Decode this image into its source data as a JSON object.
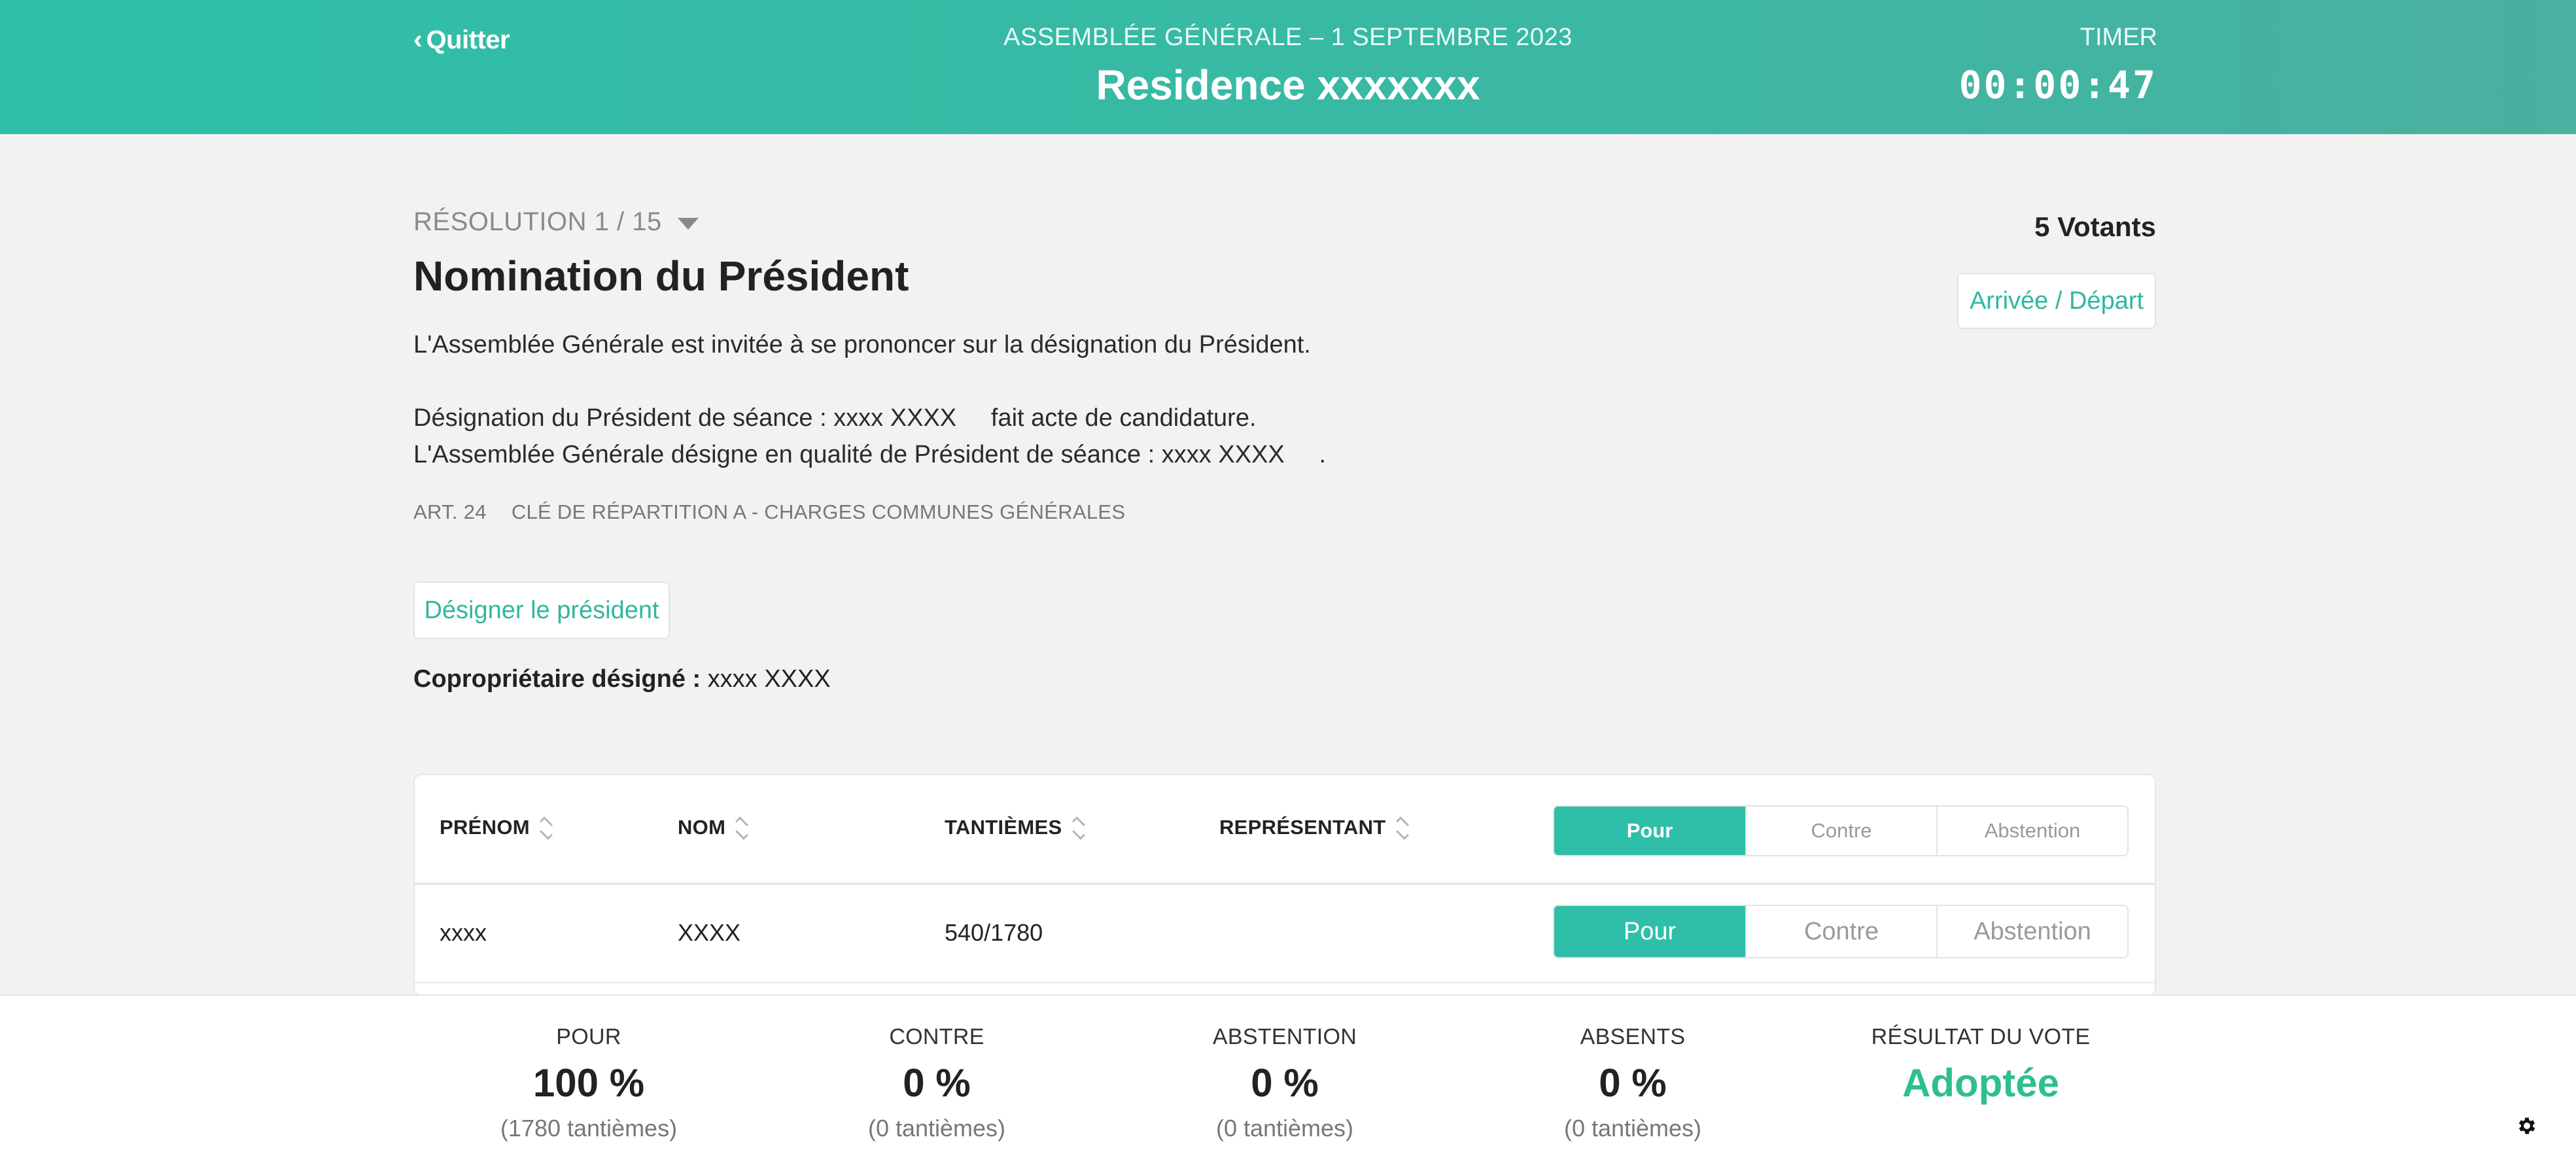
{
  "header": {
    "back_label": "Quitter",
    "subtitle": "ASSEMBLÉE GÉNÉRALE – 1 SEPTEMBRE 2023",
    "title": "Residence xxxxxxx",
    "timer_label": "TIMER",
    "timer_value": "00:00:47"
  },
  "resolution": {
    "counter": "RÉSOLUTION 1 / 15",
    "title": "Nomination du Président",
    "votants": "5 Votants",
    "arrival_button": "Arrivée / Départ",
    "description_lines": [
      "L'Assemblée Générale est invitée à se prononcer sur la désignation du Président.",
      "Désignation du Président de séance : xxxx XXXX     fait acte de candidature.",
      "L'Assemblée Générale désigne en qualité de Président de séance : xxxx XXXX     ."
    ],
    "article": "ART. 24",
    "cle": "CLÉ DE RÉPARTITION A - CHARGES COMMUNES GÉNÉRALES",
    "designate_button": "Désigner le président",
    "designated_label": "Copropriétaire désigné :",
    "designated_value": "xxxx XXXX"
  },
  "table": {
    "headers": {
      "prenom": "PRÉNOM",
      "nom": "NOM",
      "tantiemes": "TANTIÈMES",
      "representant": "REPRÉSENTANT"
    },
    "bulk_vote": {
      "pour": "Pour",
      "contre": "Contre",
      "abstention": "Abstention",
      "selected": "pour"
    },
    "rows": [
      {
        "prenom": "xxxx",
        "nom": "XXXX",
        "tantiemes": "540/1780",
        "representant": "",
        "vote": {
          "pour": "Pour",
          "contre": "Contre",
          "abstention": "Abstention",
          "selected": "pour"
        }
      }
    ]
  },
  "footer": {
    "pour": {
      "label": "POUR",
      "value": "100 %",
      "sub": "(1780 tantièmes)"
    },
    "contre": {
      "label": "CONTRE",
      "value": "0 %",
      "sub": "(0 tantièmes)"
    },
    "abstention": {
      "label": "ABSTENTION",
      "value": "0 %",
      "sub": "(0 tantièmes)"
    },
    "absents": {
      "label": "ABSENTS",
      "value": "0 %",
      "sub": "(0 tantièmes)"
    },
    "result": {
      "label": "RÉSULTAT DU VOTE",
      "value": "Adoptée"
    },
    "accent_green": "#2fbf8f"
  },
  "icons": {
    "settings": "gear-icon",
    "sort": "sort-icon",
    "dropdown": "chevron-down-icon",
    "back": "chevron-left-icon"
  },
  "colors": {
    "brand": "#2fbfa8",
    "accent_text": "#2fb89e"
  }
}
